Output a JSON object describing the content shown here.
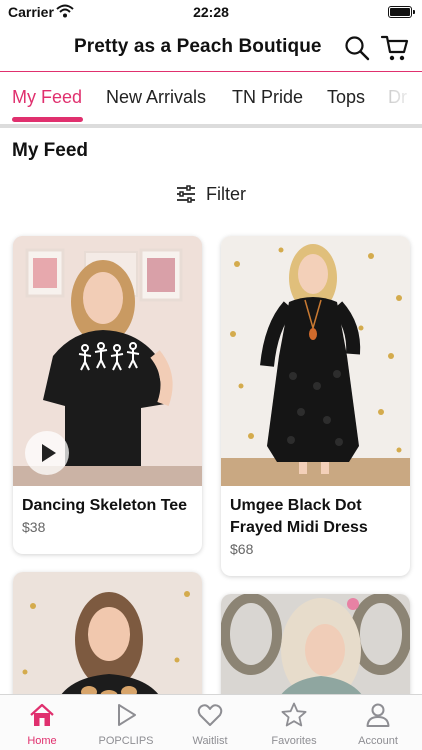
{
  "status_bar": {
    "carrier": "Carrier",
    "time": "22:28"
  },
  "header": {
    "title": "Pretty as a Peach Boutique",
    "icons": [
      "search-icon",
      "cart-icon"
    ]
  },
  "tabs": [
    {
      "label": "My Feed",
      "active": true
    },
    {
      "label": "New Arrivals",
      "active": false
    },
    {
      "label": "TN Pride",
      "active": false
    },
    {
      "label": "Tops",
      "active": false
    },
    {
      "label": "Dr",
      "active": false
    }
  ],
  "section": {
    "title": "My Feed",
    "filter_label": "Filter"
  },
  "products": [
    {
      "name": "Dancing Skeleton Tee",
      "price": "$38",
      "has_video": true
    },
    {
      "name": "Umgee Black Dot Frayed Midi Dress",
      "price": "$68",
      "has_video": false
    },
    {
      "name": "",
      "price": "",
      "has_video": false
    },
    {
      "name": "",
      "price": "",
      "has_video": false
    }
  ],
  "bottom_nav": [
    {
      "label": "Home",
      "icon": "home-icon",
      "active": true
    },
    {
      "label": "POPCLIPS",
      "icon": "play-icon",
      "active": false
    },
    {
      "label": "Waitlist",
      "icon": "heart-icon",
      "active": false
    },
    {
      "label": "Favorites",
      "icon": "star-icon",
      "active": false
    },
    {
      "label": "Account",
      "icon": "person-icon",
      "active": false
    }
  ],
  "colors": {
    "accent": "#e0306e",
    "inactive": "#8e8e93"
  }
}
